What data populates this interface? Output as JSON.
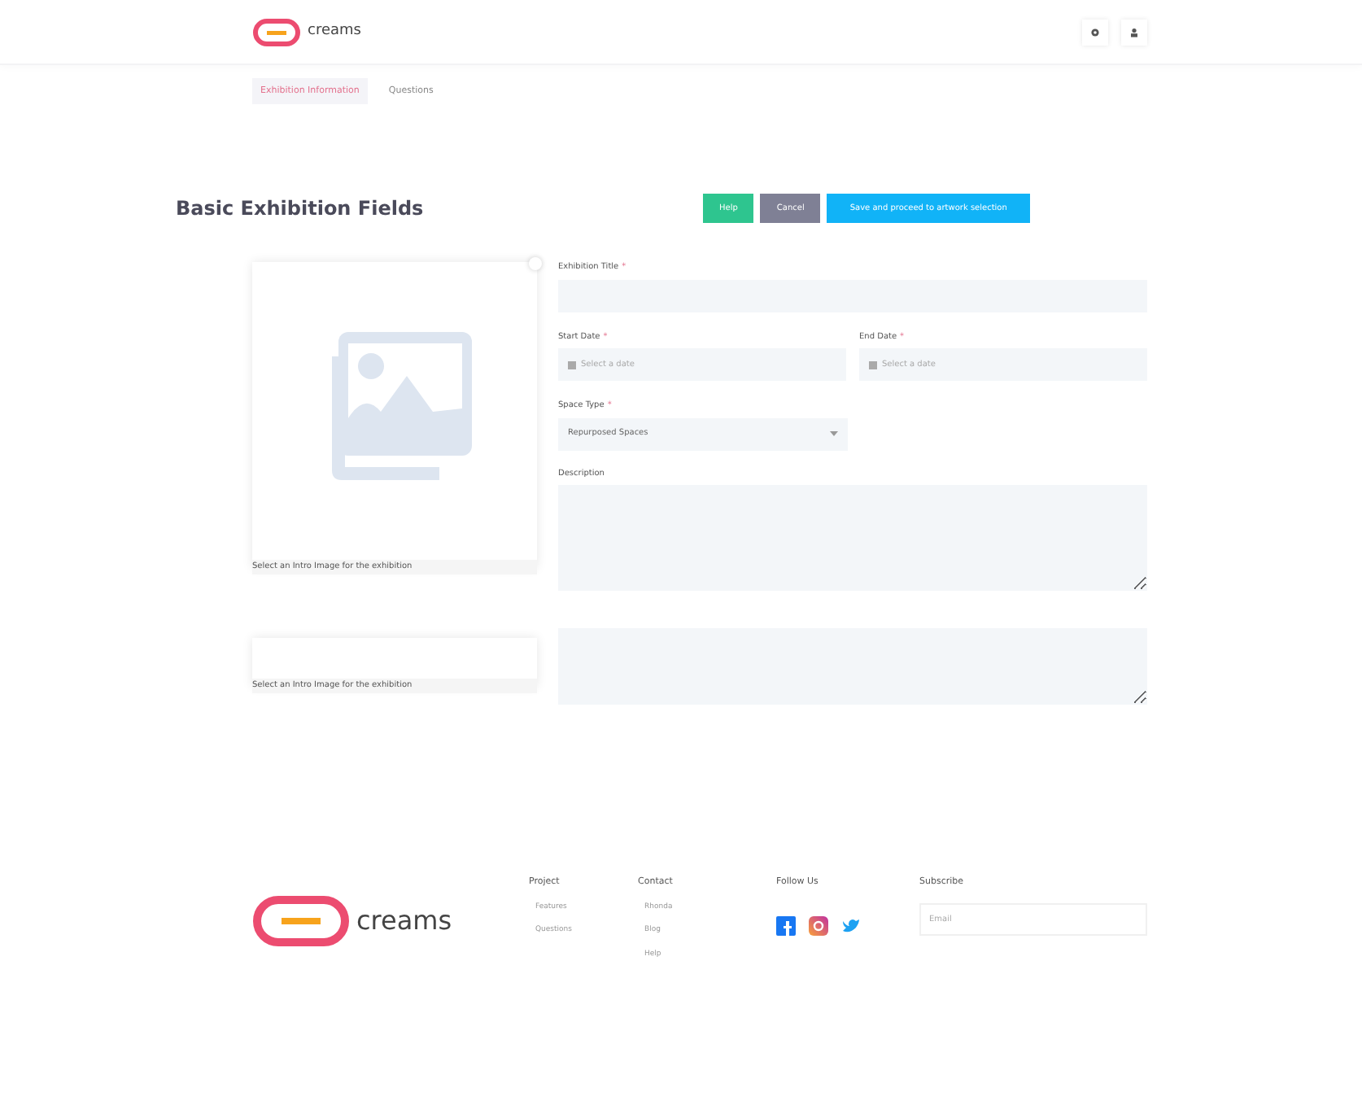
{
  "header": {
    "brand": "creams",
    "icons": [
      {
        "kind": "settings"
      },
      {
        "kind": "user"
      }
    ]
  },
  "tabs": [
    {
      "label": "Exhibition Information",
      "selected": true
    },
    {
      "label": "Questions",
      "selected": false
    }
  ],
  "page_title": "Basic Exhibition Fields",
  "actions": [
    {
      "label": "Help",
      "kind": "success"
    },
    {
      "label": "Cancel",
      "kind": "secondary"
    },
    {
      "label": "Save and proceed to artwork selection",
      "kind": "info"
    }
  ],
  "images": [
    {
      "caption": "Select an Intro Image for the exhibition",
      "kind": "placeholder"
    },
    {
      "caption": "Select an Intro Image for the exhibition",
      "kind": "empty"
    }
  ],
  "form": {
    "title": {
      "label": "Exhibition Title",
      "required_mark": "*"
    },
    "start_date": {
      "label": "Start Date",
      "required_mark": "*",
      "placeholder": "Select a date"
    },
    "end_date": {
      "label": "End Date",
      "required_mark": "*",
      "placeholder": "Select a date"
    },
    "space_type": {
      "label": "Space Type",
      "required_mark": "*",
      "value": "Repurposed Spaces"
    },
    "description": {
      "label": "Description"
    }
  },
  "footer": {
    "brand": "creams",
    "columns": [
      {
        "heading": "Project",
        "links": [
          "Features",
          "Questions"
        ]
      },
      {
        "heading": "Contact",
        "links": [
          "Rhonda",
          "Blog",
          "Help"
        ]
      }
    ],
    "follow": {
      "heading": "Follow Us",
      "icons": [
        {
          "kind": "facebook"
        },
        {
          "kind": "instagram"
        },
        {
          "kind": "twitter"
        }
      ]
    },
    "subscribe": {
      "heading": "Subscribe",
      "placeholder": "Email"
    }
  }
}
